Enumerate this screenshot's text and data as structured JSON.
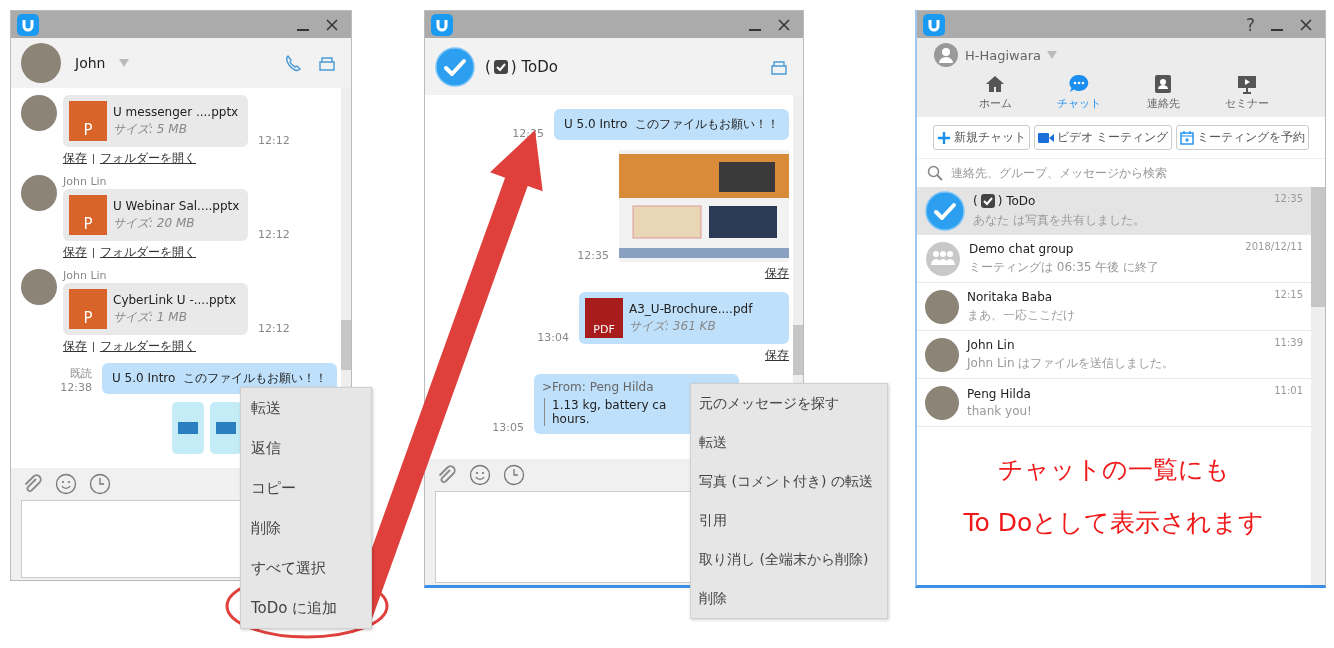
{
  "john_chat": {
    "contact": {
      "name": "John"
    },
    "messages": [
      {
        "kind": "received_pptx_file",
        "icon_label": "P",
        "file_name": "U messenger ....pptx",
        "size": "サイズ: 5 MB",
        "time": "12:12",
        "save_label": "保存",
        "open_folder_label": "フォルダーを開く"
      },
      {
        "kind": "received_pptx_file",
        "sender": "John Lin",
        "icon_label": "P",
        "file_name": "U Webinar Sal....pptx",
        "size": "サイズ: 20 MB",
        "time": "12:12",
        "save_label": "保存",
        "open_folder_label": "フォルダーを開く"
      },
      {
        "kind": "received_pptx_file",
        "sender": "John Lin",
        "icon_label": "P",
        "file_name": "CyberLink U -....pptx",
        "size": "サイズ: 1 MB",
        "time": "12:12",
        "save_label": "保存",
        "open_folder_label": "フォルダーを開く"
      },
      {
        "kind": "sent_text",
        "read_label": "既読",
        "time": "12:38",
        "text": "U 5.0 Intro  このファイルもお願い！！"
      },
      {
        "kind": "sent_image_preview"
      }
    ],
    "context_menu": [
      {
        "label": "転送"
      },
      {
        "label": "返信"
      },
      {
        "label": "コピー"
      },
      {
        "label": "削除"
      },
      {
        "label": "すべて選択"
      },
      {
        "label": "ToDo に追加"
      }
    ]
  },
  "todo_chat": {
    "title_before": "(",
    "title_after": ") ToDo",
    "messages": [
      {
        "kind": "sent_text",
        "time": "12:35",
        "text": "U 5.0 Intro  このファイルもお願い！！"
      },
      {
        "kind": "sent_image",
        "time": "12:35",
        "save_label": "保存"
      },
      {
        "kind": "sent_pdf_file",
        "icon_label": "PDF",
        "file_name": "A3_U-Brochure....pdf",
        "size": "サイズ: 361 KB",
        "time": "13:04",
        "save_label": "保存"
      },
      {
        "kind": "sent_quote",
        "time": "13:05",
        "from": ">From: Peng Hilda",
        "lines": [
          "1.13 kg, battery ca",
          "hours."
        ]
      }
    ],
    "context_menu": [
      {
        "label": "元のメッセージを探す"
      },
      {
        "label": "転送"
      },
      {
        "label": "写真 (コメント付き) の転送"
      },
      {
        "label": "引用"
      },
      {
        "label": "取り消し (全端末から削除)"
      },
      {
        "label": "削除"
      }
    ]
  },
  "chat_list": {
    "help_label": "?",
    "user": {
      "name": "H-Hagiwara"
    },
    "nav": [
      {
        "kind": "home",
        "label": "ホーム",
        "selected": false
      },
      {
        "kind": "chat",
        "label": "チャット",
        "selected": true
      },
      {
        "kind": "contacts",
        "label": "連絡先",
        "selected": false
      },
      {
        "kind": "seminar",
        "label": "セミナー",
        "selected": false
      }
    ],
    "actions": [
      {
        "kind": "plus",
        "label": "新規チャット"
      },
      {
        "kind": "video",
        "label": "ビデオ ミーティング"
      },
      {
        "kind": "calendar",
        "label": "ミーティングを予約"
      }
    ],
    "search": {
      "placeholder": "連絡先、グループ、メッセージから検索"
    },
    "chats": [
      {
        "kind": "todo",
        "name_before": "(",
        "name": ") ToDo",
        "preview": "あなた は写真を共有しました。",
        "time": "12:35",
        "selected": true
      },
      {
        "kind": "group",
        "name": "Demo chat group",
        "preview": "ミーティングは 06:35 午後 に終了",
        "time": "2018/12/11",
        "selected": false
      },
      {
        "kind": "person",
        "name": "Noritaka Baba",
        "preview": "まあ、一応ここだけ",
        "time": "12:15",
        "selected": false
      },
      {
        "kind": "person",
        "name": "John Lin",
        "preview": "John Lin はファイルを送信しました。",
        "time": "11:39",
        "selected": false
      },
      {
        "kind": "person",
        "name": "Peng Hilda",
        "preview": "thank you!",
        "time": "11:01",
        "selected": false
      }
    ],
    "annotation": {
      "lines": [
        "チャットの一覧にも",
        "To Doとして表示されます"
      ]
    }
  }
}
